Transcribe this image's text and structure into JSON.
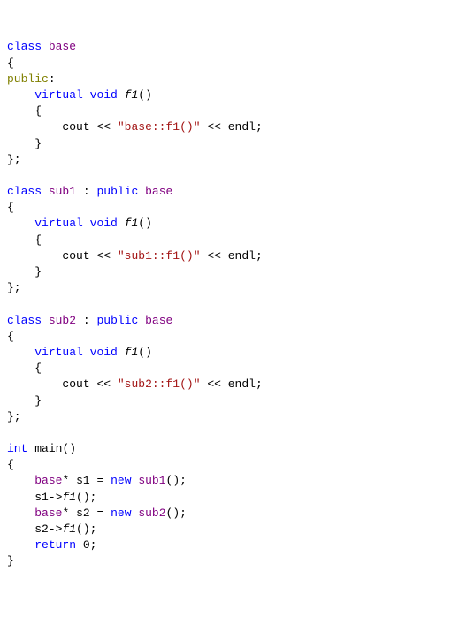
{
  "tokens": {
    "kw_class": "class",
    "kw_public": "public",
    "kw_virtual": "virtual",
    "kw_void": "void",
    "kw_int": "int",
    "kw_new": "new",
    "kw_return": "return",
    "cls_base": "base",
    "cls_sub1": "sub1",
    "cls_sub2": "sub2",
    "fn_f1": "f1",
    "fn_main": "main",
    "id_cout": "cout",
    "id_endl": "endl",
    "id_s1": "s1",
    "id_s2": "s2",
    "str_base_f1": "\"base::f1()\"",
    "str_sub1_f1": "\"sub1::f1()\"",
    "str_sub2_f1": "\"sub2::f1()\"",
    "num_zero": "0",
    "p_lbrace": "{",
    "p_rbrace": "}",
    "p_rbrace_semi": "};",
    "p_lparen": "(",
    "p_rparen": ")",
    "p_colon": ":",
    "p_semi": ";",
    "p_ltlt": "<<",
    "p_star": "*",
    "p_eq": "=",
    "p_arrow": "->",
    "p_parens": "()",
    "p_parens_semi": "();",
    "sp": " ",
    "indent1": "    ",
    "indent2": "        "
  }
}
